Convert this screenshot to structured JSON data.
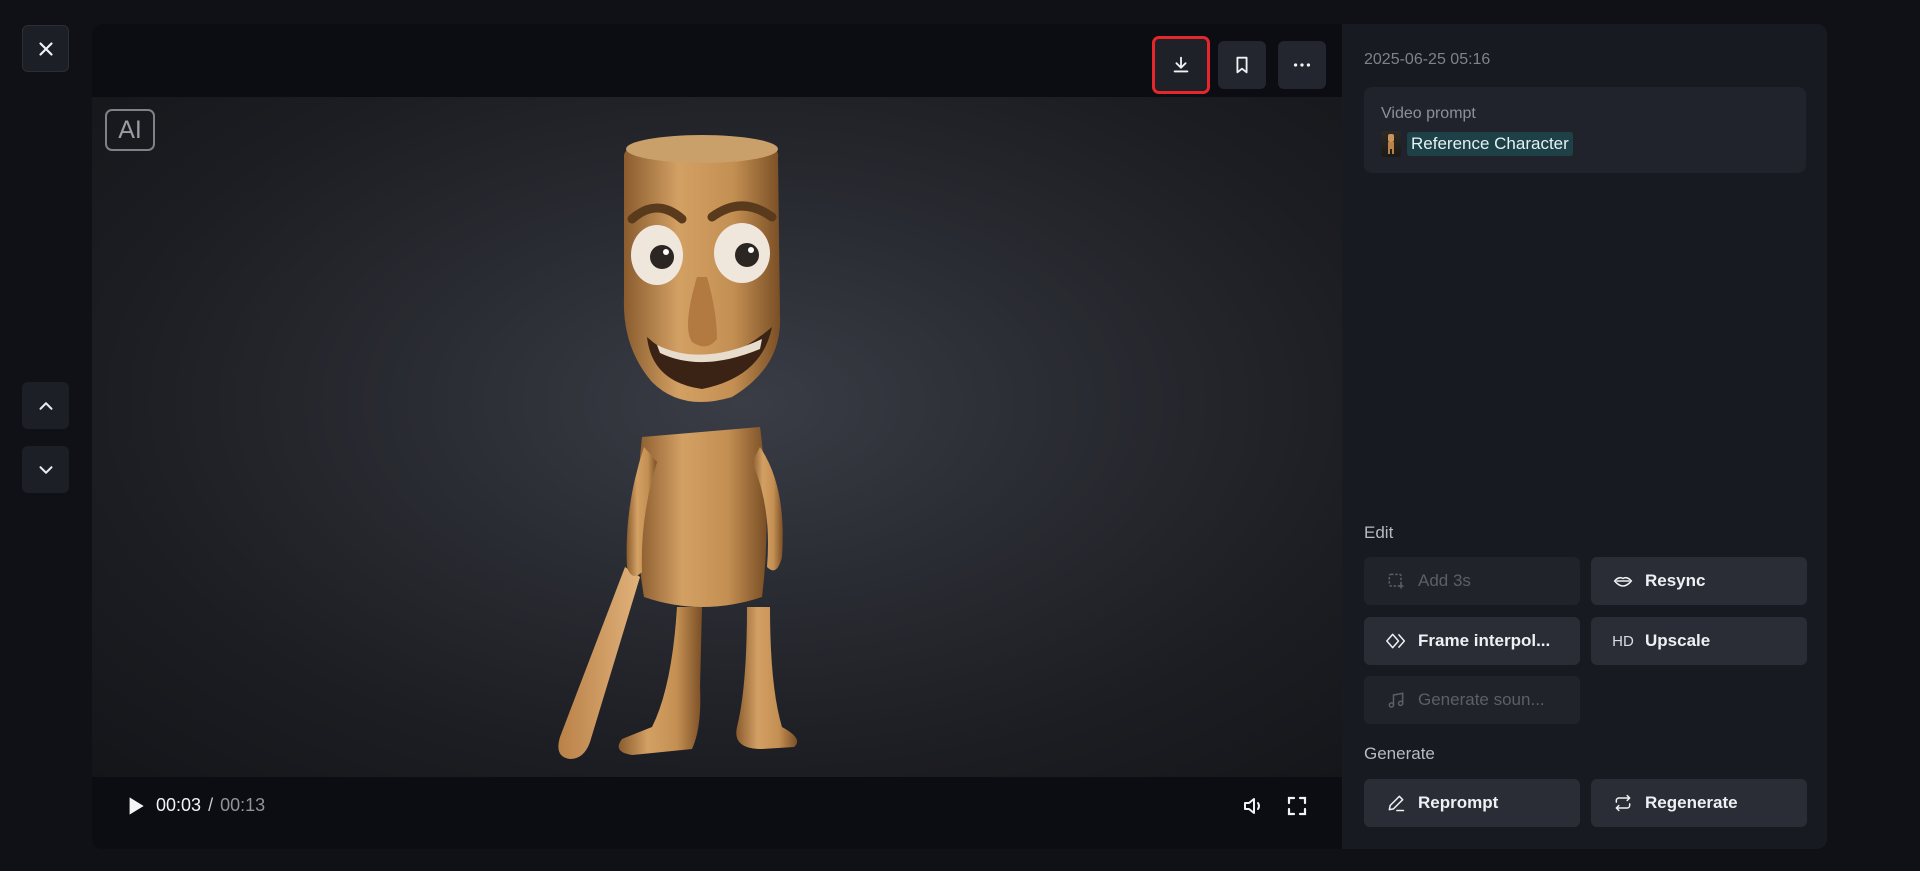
{
  "nav": {
    "close_icon": "close-icon",
    "prev_icon": "chevron-up-icon",
    "next_icon": "chevron-down-icon"
  },
  "player": {
    "toolbar": {
      "download_icon": "download-icon",
      "bookmark_icon": "bookmark-icon",
      "more_icon": "more-horizontal-icon"
    },
    "ai_badge": "AI",
    "progress_fraction": 0.23,
    "current_time": "00:03",
    "separator": "/",
    "duration": "00:13"
  },
  "sidebar": {
    "timestamp": "2025-06-25 05:16",
    "prompt": {
      "label": "Video prompt",
      "reference": "Reference Character"
    },
    "edit": {
      "label": "Edit",
      "actions": [
        {
          "label": "Add 3s",
          "icon": "add-clip-icon",
          "disabled": true
        },
        {
          "label": "Resync",
          "icon": "lips-icon",
          "disabled": false
        },
        {
          "label": "Frame interpol...",
          "icon": "diamonds-icon",
          "disabled": false
        },
        {
          "label": "Upscale",
          "icon": "HD",
          "disabled": false
        },
        {
          "label": "Generate soun...",
          "icon": "music-note-icon",
          "disabled": true
        }
      ]
    },
    "generate": {
      "label": "Generate",
      "actions": [
        {
          "label": "Reprompt",
          "icon": "pencil-icon"
        },
        {
          "label": "Regenerate",
          "icon": "repeat-icon"
        }
      ]
    }
  },
  "colors": {
    "highlight": "#e5262b",
    "chip_bg": "#1e4148",
    "panel_bg": "#161920"
  }
}
